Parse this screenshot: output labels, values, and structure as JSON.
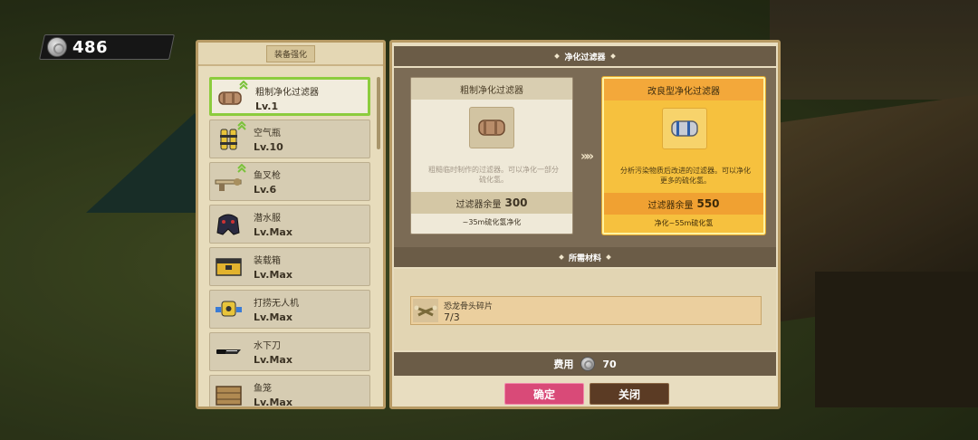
{
  "currency": {
    "icon": "silver-coin-icon",
    "amount": "486"
  },
  "equipment_panel": {
    "title": "装备强化",
    "items": [
      {
        "name": "粗制净化过滤器",
        "level": "Lv.1",
        "icon": "filter-icon",
        "upgradable": true,
        "selected": true
      },
      {
        "name": "空气瓶",
        "level": "Lv.10",
        "icon": "air-tank-icon",
        "upgradable": true,
        "selected": false
      },
      {
        "name": "鱼叉枪",
        "level": "Lv.6",
        "icon": "harpoon-gun-icon",
        "upgradable": true,
        "selected": false
      },
      {
        "name": "潜水服",
        "level": "Lv.Max",
        "icon": "diving-suit-icon",
        "upgradable": false,
        "selected": false
      },
      {
        "name": "装载箱",
        "level": "Lv.Max",
        "icon": "cargo-box-icon",
        "upgradable": false,
        "selected": false
      },
      {
        "name": "打捞无人机",
        "level": "Lv.Max",
        "icon": "drone-icon",
        "upgradable": false,
        "selected": false
      },
      {
        "name": "水下刀",
        "level": "Lv.Max",
        "icon": "knife-icon",
        "upgradable": false,
        "selected": false
      },
      {
        "name": "鱼笼",
        "level": "Lv.Max",
        "icon": "fish-trap-icon",
        "upgradable": false,
        "selected": false
      }
    ]
  },
  "upgrade": {
    "section_title": "净化过滤器",
    "current": {
      "title": "粗制净化过滤器",
      "description": "粗糙临时制作的过滤器。可以净化一部分硫化氢。",
      "stock_label": "过滤器余量",
      "stock_value": "300",
      "effect": "~35m硫化氢净化"
    },
    "next": {
      "title": "改良型净化过滤器",
      "description": "分析污染物质后改进的过滤器。可以净化更多的硫化氢。",
      "stock_label": "过滤器余量",
      "stock_value": "550",
      "effect": "净化~55m硫化氢"
    },
    "arrow": "»»"
  },
  "materials": {
    "section_title": "所需材料",
    "items": [
      {
        "name": "恐龙骨头碎片",
        "count": "7/3",
        "icon": "dinosaur-bone-icon"
      }
    ]
  },
  "cost": {
    "label": "费用",
    "value": "70",
    "icon": "silver-coin-icon"
  },
  "buttons": {
    "confirm": "确定",
    "close": "关闭"
  },
  "colors": {
    "selected_border": "#8ccc3d",
    "confirm": "#d94a78",
    "close": "#5b3b24",
    "highlight_card": "#f6c13e"
  }
}
